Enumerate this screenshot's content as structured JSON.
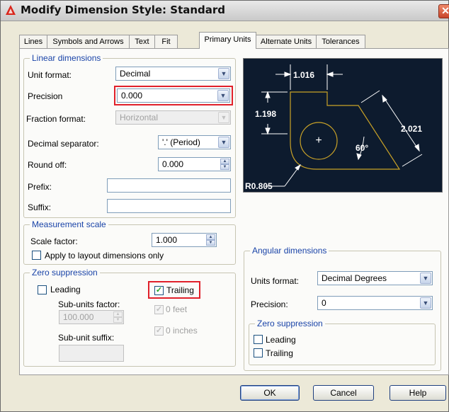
{
  "window": {
    "title": "Modify Dimension Style: Standard",
    "close_glyph": "✕",
    "app_icon": "autocad-a-icon"
  },
  "tabs": [
    "Lines",
    "Symbols and Arrows",
    "Text",
    "Fit",
    "Primary Units",
    "Alternate Units",
    "Tolerances"
  ],
  "active_tab": "Primary Units",
  "linear": {
    "title": "Linear dimensions",
    "unit_format_label": "Unit format:",
    "unit_format_value": "Decimal",
    "precision_label": "Precision",
    "precision_value": "0.000",
    "fraction_format_label": "Fraction format:",
    "fraction_format_value": "Horizontal",
    "decimal_sep_label": "Decimal separator:",
    "decimal_sep_value": "'.' (Period)",
    "round_off_label": "Round off:",
    "round_off_value": "0.000",
    "prefix_label": "Prefix:",
    "prefix_value": "",
    "suffix_label": "Suffix:",
    "suffix_value": ""
  },
  "measurement": {
    "title": "Measurement scale",
    "scale_label": "Scale factor:",
    "scale_value": "1.000",
    "apply_layout_label": "Apply to layout dimensions only",
    "apply_layout_checked": false
  },
  "zero": {
    "title": "Zero suppression",
    "leading_label": "Leading",
    "leading_checked": false,
    "trailing_label": "Trailing",
    "trailing_checked": true,
    "subunits_factor_label": "Sub-units factor:",
    "subunits_factor_value": "100.000",
    "zero_feet_label": "0 feet",
    "zero_feet_checked": true,
    "zero_inches_label": "0 inches",
    "zero_inches_checked": true,
    "subunit_suffix_label": "Sub-unit suffix:",
    "subunit_suffix_value": ""
  },
  "preview": {
    "dim_top": "1.016",
    "dim_left": "1.198",
    "dim_right": "2.021",
    "angle": "60°",
    "radius": "R0.805",
    "center_mark": "+"
  },
  "angular": {
    "title": "Angular dimensions",
    "units_format_label": "Units format:",
    "units_format_value": "Decimal Degrees",
    "precision_label": "Precision:",
    "precision_value": "0",
    "zero_title": "Zero suppression",
    "leading_label": "Leading",
    "leading_checked": false,
    "trailing_label": "Trailing",
    "trailing_checked": false
  },
  "buttons": {
    "ok": "OK",
    "cancel": "Cancel",
    "help": "Help"
  },
  "colors": {
    "highlight": "#e0202a",
    "group_title": "#1a44a8",
    "preview_bg": "#0d1b2e",
    "preview_geometry": "#c9a227"
  },
  "glyphs": {
    "dropdown": "▼",
    "spin_up": "▲",
    "spin_down": "▼",
    "check": "✓"
  }
}
